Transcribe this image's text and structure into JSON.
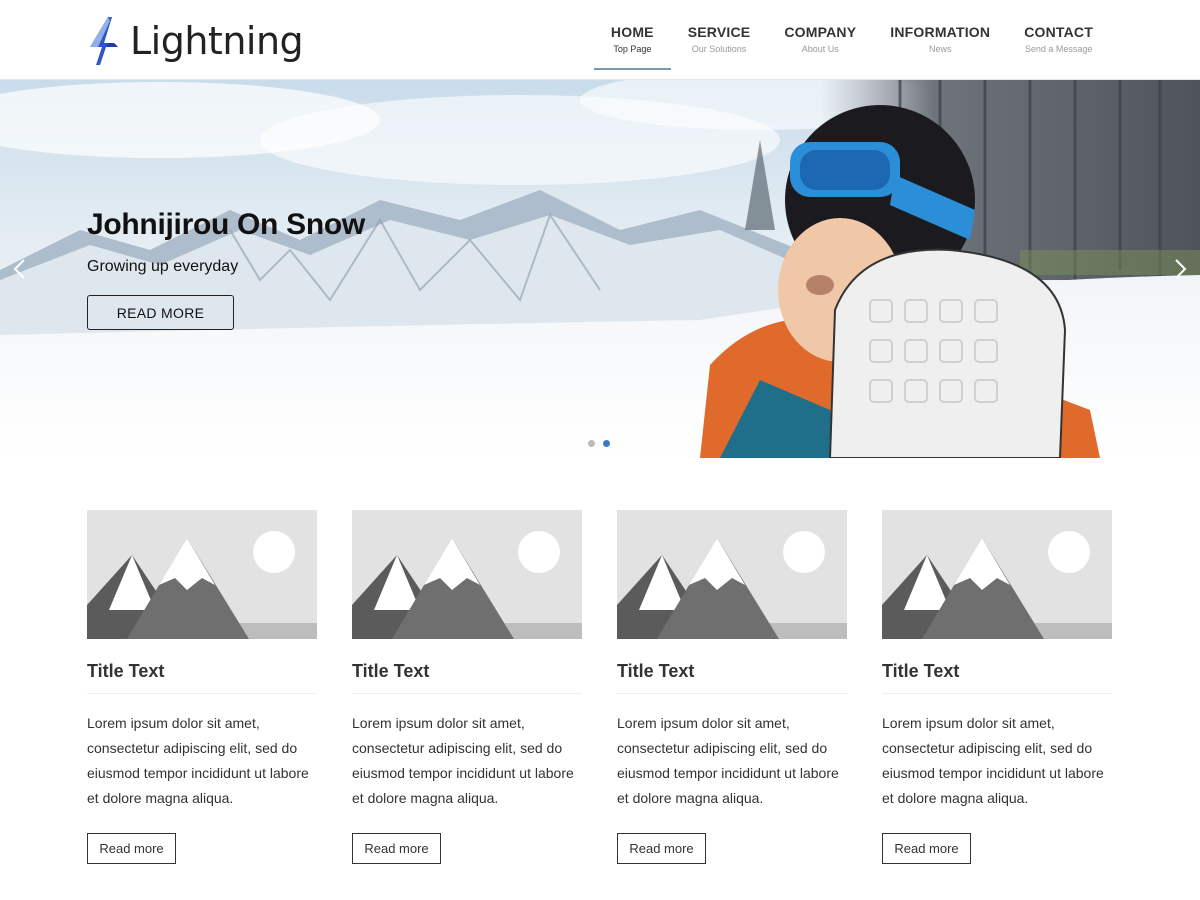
{
  "brand": {
    "name": "Lightning",
    "accent": "#3b5fc0"
  },
  "nav": [
    {
      "label": "HOME",
      "sub": "Top Page",
      "active": true
    },
    {
      "label": "SERVICE",
      "sub": "Our Solutions"
    },
    {
      "label": "COMPANY",
      "sub": "About Us"
    },
    {
      "label": "INFORMATION",
      "sub": "News"
    },
    {
      "label": "CONTACT",
      "sub": "Send a Message"
    }
  ],
  "hero": {
    "title": "Johnijirou On Snow",
    "subtitle": "Growing up everyday",
    "button": "READ MORE",
    "slide_count": 2,
    "active_slide": 2,
    "dot_active_color": "#3b79c6"
  },
  "cards": [
    {
      "title": "Title Text",
      "text": "Lorem ipsum dolor sit amet, consectetur adipiscing elit, sed do eiusmod tempor incididunt ut labore et dolore magna aliqua.",
      "button": "Read more"
    },
    {
      "title": "Title Text",
      "text": "Lorem ipsum dolor sit amet, consectetur adipiscing elit, sed do eiusmod tempor incididunt ut labore et dolore magna aliqua.",
      "button": "Read more"
    },
    {
      "title": "Title Text",
      "text": "Lorem ipsum dolor sit amet, consectetur adipiscing elit, sed do eiusmod tempor incididunt ut labore et dolore magna aliqua.",
      "button": "Read more"
    },
    {
      "title": "Title Text",
      "text": "Lorem ipsum dolor sit amet, consectetur adipiscing elit, sed do eiusmod tempor incididunt ut labore et dolore magna aliqua.",
      "button": "Read more"
    }
  ]
}
